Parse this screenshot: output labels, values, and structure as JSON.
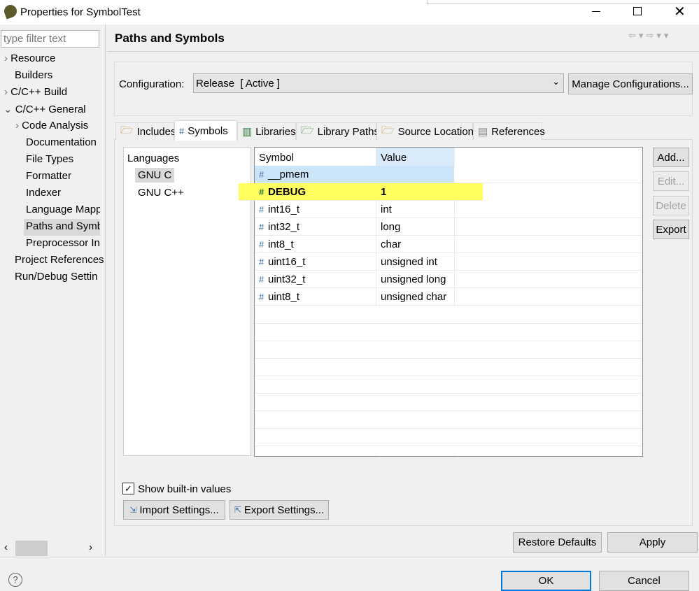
{
  "window": {
    "title": "Properties for SymbolTest"
  },
  "sidebar": {
    "filter_placeholder": "type filter text",
    "items": [
      {
        "label": "Resource",
        "arrow": "›"
      },
      {
        "label": "Builders",
        "arrow": ""
      },
      {
        "label": "C/C++ Build",
        "arrow": "›"
      },
      {
        "label": "C/C++ General",
        "arrow": "⌄"
      },
      {
        "label": "Code Analysis",
        "arrow": "›"
      },
      {
        "label": "Documentation"
      },
      {
        "label": "File Types"
      },
      {
        "label": "Formatter"
      },
      {
        "label": "Indexer"
      },
      {
        "label": "Language Mapp"
      },
      {
        "label": "Paths and Symb"
      },
      {
        "label": "Preprocessor In"
      },
      {
        "label": "Project References"
      },
      {
        "label": "Run/Debug Settin"
      }
    ]
  },
  "header": {
    "title": "Paths and Symbols"
  },
  "config": {
    "label": "Configuration:",
    "value": "Release  [ Active ]",
    "manage": "Manage Configurations..."
  },
  "tabs": [
    "Includes",
    "Symbols",
    "Libraries",
    "Library Paths",
    "Source Location",
    "References"
  ],
  "languages": {
    "header": "Languages",
    "items": [
      "GNU C",
      "GNU C++"
    ]
  },
  "table": {
    "headers": [
      "Symbol",
      "Value"
    ],
    "rows": [
      {
        "symbol": "__pmem",
        "value": ""
      },
      {
        "symbol": "DEBUG",
        "value": "1"
      },
      {
        "symbol": "int16_t",
        "value": "int"
      },
      {
        "symbol": "int32_t",
        "value": "long"
      },
      {
        "symbol": "int8_t",
        "value": "char"
      },
      {
        "symbol": "uint16_t",
        "value": "unsigned int"
      },
      {
        "symbol": "uint32_t",
        "value": "unsigned long"
      },
      {
        "symbol": "uint8_t",
        "value": "unsigned char"
      }
    ]
  },
  "side_buttons": {
    "add": "Add...",
    "edit": "Edit...",
    "delete": "Delete",
    "export": "Export"
  },
  "show_builtin": "Show built-in values",
  "import_settings": "Import Settings...",
  "export_settings": "Export Settings...",
  "restore_defaults": "Restore Defaults",
  "apply": "Apply",
  "ok": "OK",
  "cancel": "Cancel"
}
